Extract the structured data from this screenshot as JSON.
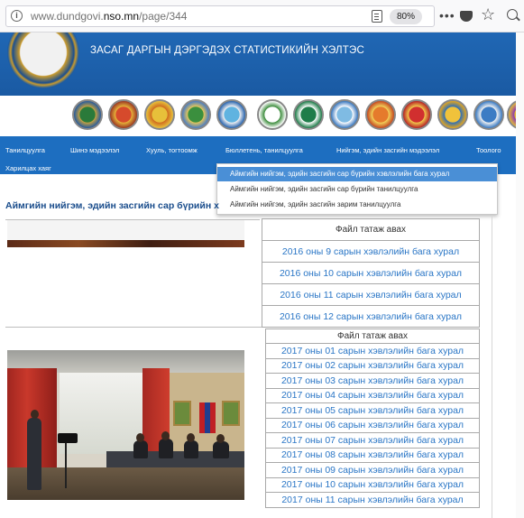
{
  "browser": {
    "url_prefix": "www.dundgovi.",
    "url_domain": "nso.mn",
    "url_path": "/page/344",
    "zoom": "80%",
    "menu_dots": "•••",
    "star": "☆"
  },
  "header": {
    "org_title": "ЗАСАГ ДАРГЫН ДЭРГЭДЭХ СТАТИСТИКИЙН ХЭЛТЭС"
  },
  "nav": {
    "items": [
      "Танилцуулга",
      "Шинэ мэдээлэл",
      "Хууль, тогтоомж",
      "Бюллетень, танилцуулга",
      "Нийгэм, эдийн засгийн мэдээлэл",
      "Тоолого"
    ],
    "second_row": "Харилцах хаяг",
    "dropdown": [
      "Аймгийн нийгэм, эдийн засгийн сар бүрийн хэвлэлийн бага хурал",
      "Аймгийн нийгэм, эдийн засгийн сар бүрийн танилцуулга",
      "Аймгийн нийгэм, эдийн засгийн зарим танилцуулга"
    ]
  },
  "main": {
    "heading": "Аймгийн нийгэм, эдийн засгийн сар бүрийн х",
    "table1": {
      "header": "Файл татаж авах",
      "rows": [
        "2016 оны 9 сарын хэвлэлийн бага хурал",
        "2016 оны 10 сарын хэвлэлийн бага хурал",
        "2016 оны 11 сарын хэвлэлийн бага хурал",
        "2016 оны 12 сарын хэвлэлийн бага хурал"
      ]
    },
    "table2": {
      "header": "Файл татаж авах",
      "rows": [
        "2017 оны 01 сарын хэвлэлийн бага хурал",
        "2017 оны 02 сарын хэвлэлийн бага хурал",
        "2017 оны 03 сарын хэвлэлийн бага хурал",
        "2017 оны 04 сарын хэвлэлийн бага хурал",
        "2017 оны 05 сарын хэвлэлийн бага хурал",
        "2017 оны 06 сарын хэвлэлийн бага хурал",
        "2017 оны 07 сарын хэвлэлийн бага хурал",
        "2017 оны 08 сарын хэвлэлийн бага хурал",
        "2017 оны 09 сарын хэвлэлийн бага хурал",
        "2017 оны 10 сарын хэвлэлийн бага хурал",
        "2017 оны 11 сарын хэвлэлийн бага хурал"
      ]
    }
  }
}
